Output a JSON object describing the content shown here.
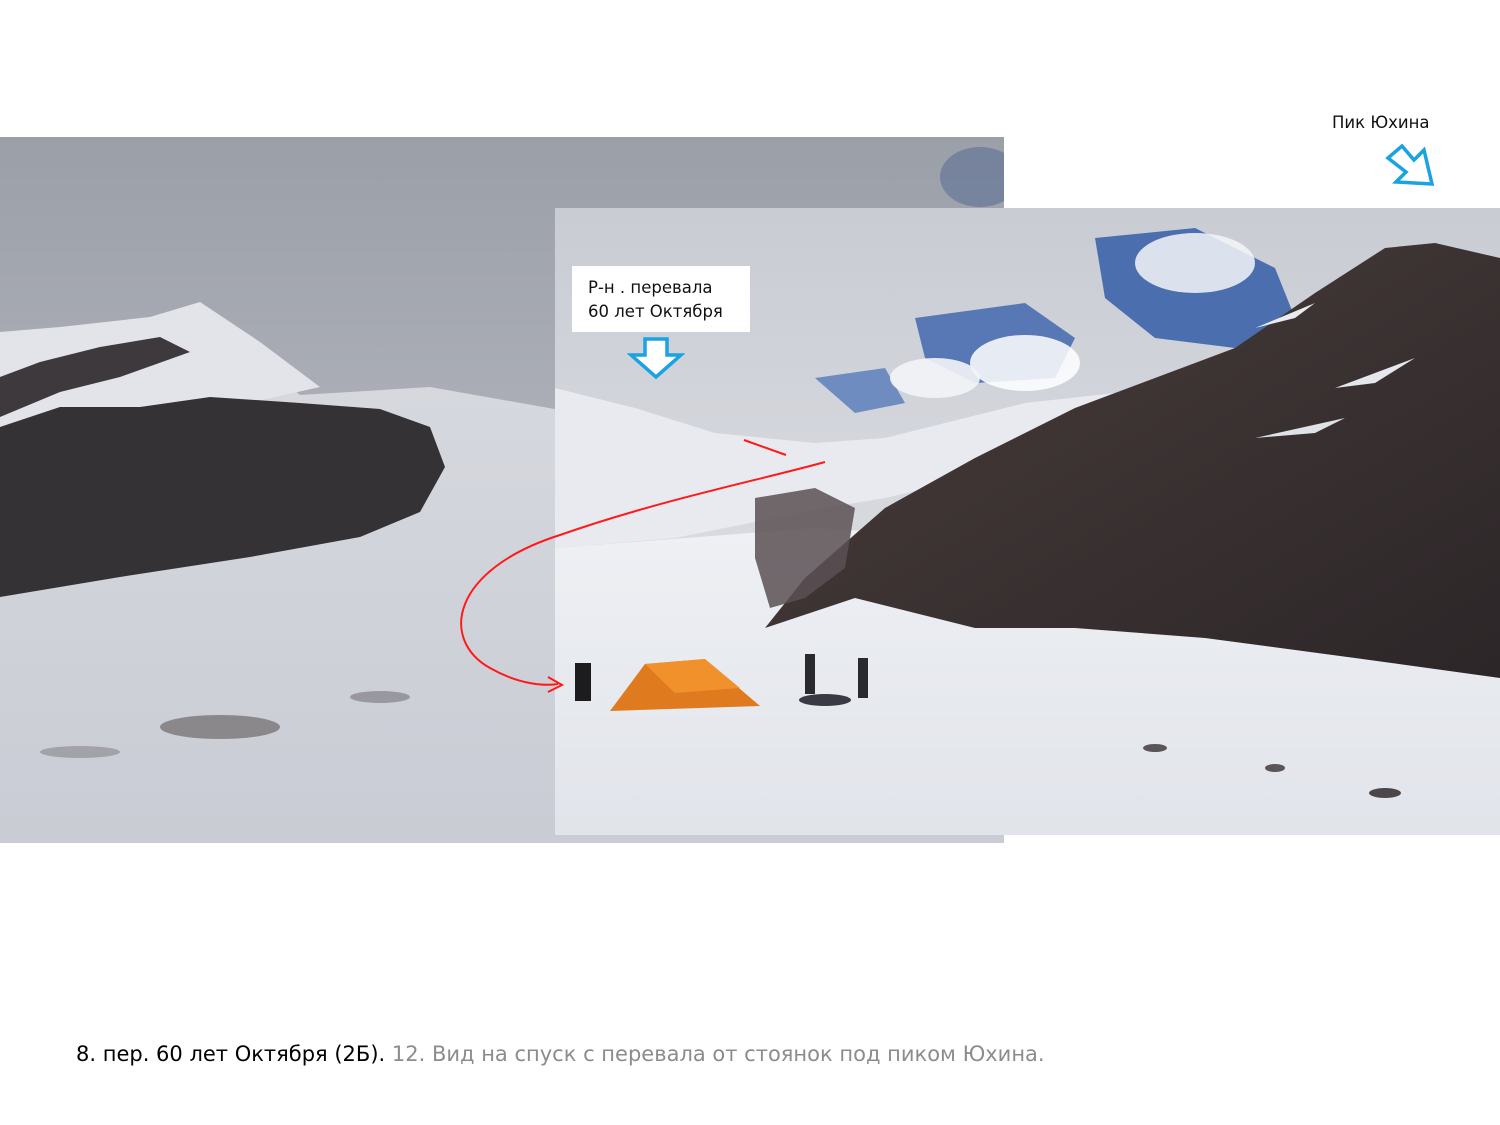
{
  "labels": {
    "pass_area_line1": "Р-н . перевала",
    "pass_area_line2": "60 лет Октября",
    "peak": "Пик Юхина"
  },
  "caption": {
    "primary": "8. пер. 60 лет Октября (2Б).",
    "secondary": "12. Вид на спуск с перевала от стоянок под пиком Юхина."
  },
  "colors": {
    "arrow": "#1aa3e0",
    "route": "#ff1a1a",
    "tent": "#e07a1e",
    "caption_secondary": "#8c8c8c"
  },
  "icons": {
    "pass_arrow": "arrow-down-icon",
    "peak_arrow": "arrow-down-right-icon"
  }
}
